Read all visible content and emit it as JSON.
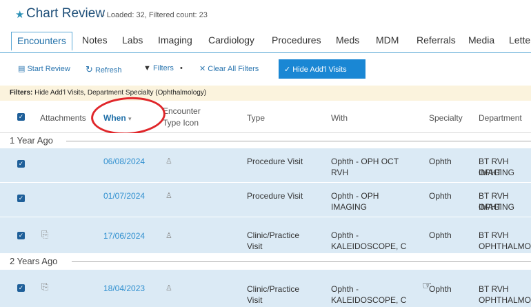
{
  "title": {
    "icon": "pin-icon",
    "text": "Chart Review",
    "subtitle": "- Loaded: 32, Filtered count: 23"
  },
  "tabs": [
    "Encounters",
    "Notes",
    "Labs",
    "Imaging",
    "Cardiology",
    "Procedures",
    "Meds",
    "MDM",
    "Referrals",
    "Media",
    "Lette"
  ],
  "toolbar": {
    "start_review": "Start Review",
    "refresh": "Refresh",
    "filters": "Filters",
    "clear_filters": "Clear All Filters",
    "hide_addl": "Hide Add'l Visits"
  },
  "filter_banner": {
    "label": "Filters:",
    "value": "Hide Add'l Visits, Department Specialty (Ophthalmology)"
  },
  "columns": {
    "attachments": "Attachments",
    "when": "When",
    "enc_icon_l1": "Encounter",
    "enc_icon_l2": "Type Icon",
    "type": "Type",
    "with": "With",
    "specialty": "Specialty",
    "department": "Department"
  },
  "groups": [
    {
      "label": "1 Year Ago",
      "rows": [
        {
          "date": "06/08/2024",
          "attachment": false,
          "type1": "Procedure Visit",
          "type2": "",
          "with1": "Ophth - OPH OCT",
          "with2": "RVH",
          "specialty": "Ophth",
          "dept1": "BT RVH OPHT",
          "dept2": "IMAGING"
        },
        {
          "date": "01/07/2024",
          "attachment": false,
          "type1": "Procedure Visit",
          "type2": "",
          "with1": "Ophth - OPH",
          "with2": "IMAGING",
          "specialty": "Ophth",
          "dept1": "BT RVH OPHT",
          "dept2": "IMAGING"
        },
        {
          "date": "17/06/2024",
          "attachment": true,
          "type1": "Clinic/Practice",
          "type2": "Visit",
          "with1": "Ophth -",
          "with2": "KALEIDOSCOPE, C",
          "specialty": "Ophth",
          "dept1": "BT RVH",
          "dept2": "OPHTHALMO"
        }
      ]
    },
    {
      "label": "2 Years Ago",
      "rows": [
        {
          "date": "18/04/2023",
          "attachment": true,
          "type1": "Clinic/Practice",
          "type2": "Visit",
          "with1": "Ophth -",
          "with2": "KALEIDOSCOPE, C",
          "specialty": "Ophth",
          "dept1": "BT RVH",
          "dept2": "OPHTHALMO"
        }
      ]
    }
  ],
  "colors": {
    "accent": "#1a87d4",
    "row_bg": "#dbeaf5",
    "link": "#2f8fcf",
    "highlight_circle": "#e0262a",
    "filter_bg": "#fbf3dd"
  }
}
